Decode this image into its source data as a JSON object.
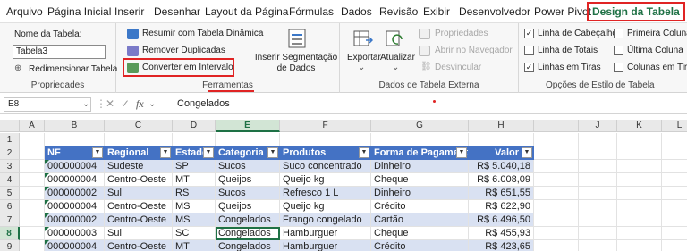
{
  "menu": {
    "tabs": [
      "Arquivo",
      "Página Inicial",
      "Inserir",
      "Desenhar",
      "Layout da Página",
      "Fórmulas",
      "Dados",
      "Revisão",
      "Exibir",
      "Desenvolvedor",
      "Power Pivot",
      "Design da Tabela"
    ],
    "active": "Design da Tabela"
  },
  "ribbon": {
    "propriedades": {
      "name_label": "Nome da Tabela:",
      "name_value": "Tabela3",
      "resize": "Redimensionar Tabela",
      "group": "Propriedades"
    },
    "ferramentas": {
      "summarize": "Resumir com Tabela Dinâmica",
      "remove_dup": "Remover Duplicadas",
      "convert": "Converter em Intervalo",
      "slicer": "Inserir Segmentação de Dados",
      "group": "Ferramentas"
    },
    "externos": {
      "export": "Exportar",
      "refresh": "Atualizar",
      "properties": "Propriedades",
      "open_browser": "Abrir no Navegador",
      "unlink": "Desvincular",
      "group": "Dados de Tabela Externa"
    },
    "estilo": {
      "header_row": "Linha de Cabeçalho",
      "total_row": "Linha de Totais",
      "banded_rows": "Linhas em Tiras",
      "first_col": "Primeira Coluna",
      "last_col": "Última Coluna",
      "banded_cols": "Colunas em Tiras",
      "group": "Opções de Estilo de Tabela"
    }
  },
  "formula_bar": {
    "cell_ref": "E8",
    "value": "Congelados",
    "cancel": "✕",
    "enter": "✓",
    "fx": "fx"
  },
  "grid": {
    "columns": [
      "A",
      "B",
      "C",
      "D",
      "E",
      "F",
      "G",
      "H",
      "I",
      "J",
      "K",
      "L"
    ],
    "rows": [
      "1",
      "2",
      "3",
      "4",
      "5",
      "6",
      "7",
      "8",
      "9"
    ],
    "selected_column": "E",
    "selected_row": "8",
    "headers": [
      "NF",
      "Regional",
      "Estado",
      "Categoria",
      "Produtos",
      "Forma de Pagamento",
      "Valor"
    ],
    "data": [
      [
        "000000004",
        "Sudeste",
        "SP",
        "Sucos",
        "Suco concentrado",
        "Dinheiro",
        "R$ 5.040,18"
      ],
      [
        "000000004",
        "Centro-Oeste",
        "MT",
        "Queijos",
        "Queijo kg",
        "Cheque",
        "R$ 6.008,09"
      ],
      [
        "000000002",
        "Sul",
        "RS",
        "Sucos",
        "Refresco 1 L",
        "Dinheiro",
        "R$ 651,55"
      ],
      [
        "000000004",
        "Centro-Oeste",
        "MS",
        "Queijos",
        "Queijo kg",
        "Crédito",
        "R$ 622,90"
      ],
      [
        "000000002",
        "Centro-Oeste",
        "MS",
        "Congelados",
        "Frango congelado",
        "Cartão",
        "R$ 6.496,50"
      ],
      [
        "000000003",
        "Sul",
        "SC",
        "Congelados",
        "Hamburguer",
        "Cheque",
        "R$ 455,93"
      ],
      [
        "000000004",
        "Centro-Oeste",
        "MT",
        "Congelados",
        "Hamburguer",
        "Crédito",
        "R$ 423,65"
      ]
    ]
  },
  "colors": {
    "accent_green": "#1e7145",
    "table_header": "#4472c4",
    "band_row": "#d9e1f2",
    "highlight_red": "#e02424"
  }
}
